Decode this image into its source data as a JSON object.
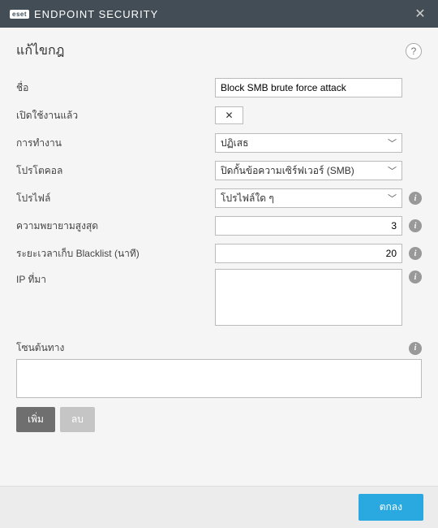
{
  "titlebar": {
    "logo": "eset",
    "product": "ENDPOINT SECURITY"
  },
  "header": {
    "title": "แก้ไขกฎ"
  },
  "form": {
    "name_label": "ชื่อ",
    "name_value": "Block SMB brute force attack",
    "enabled_label": "เปิดใช้งานแล้ว",
    "enabled_state": "✕",
    "action_label": "การทำงาน",
    "action_value": "ปฏิเสธ",
    "protocol_label": "โปรโตคอล",
    "protocol_value": "ปิดกั้นข้อความเซิร์ฟเวอร์ (SMB)",
    "profile_label": "โปรไฟล์",
    "profile_value": "โปรไฟล์ใด ๆ",
    "max_attempts_label": "ความพยายามสูงสุด",
    "max_attempts_value": "3",
    "blacklist_label": "ระยะเวลาเก็บ Blacklist (นาที)",
    "blacklist_value": "20",
    "source_ip_label": "IP ที่มา",
    "source_ip_value": "",
    "source_zone_label": "โซนต้นทาง",
    "source_zone_value": ""
  },
  "buttons": {
    "add": "เพิ่ม",
    "delete": "ลบ",
    "ok": "ตกลง"
  }
}
